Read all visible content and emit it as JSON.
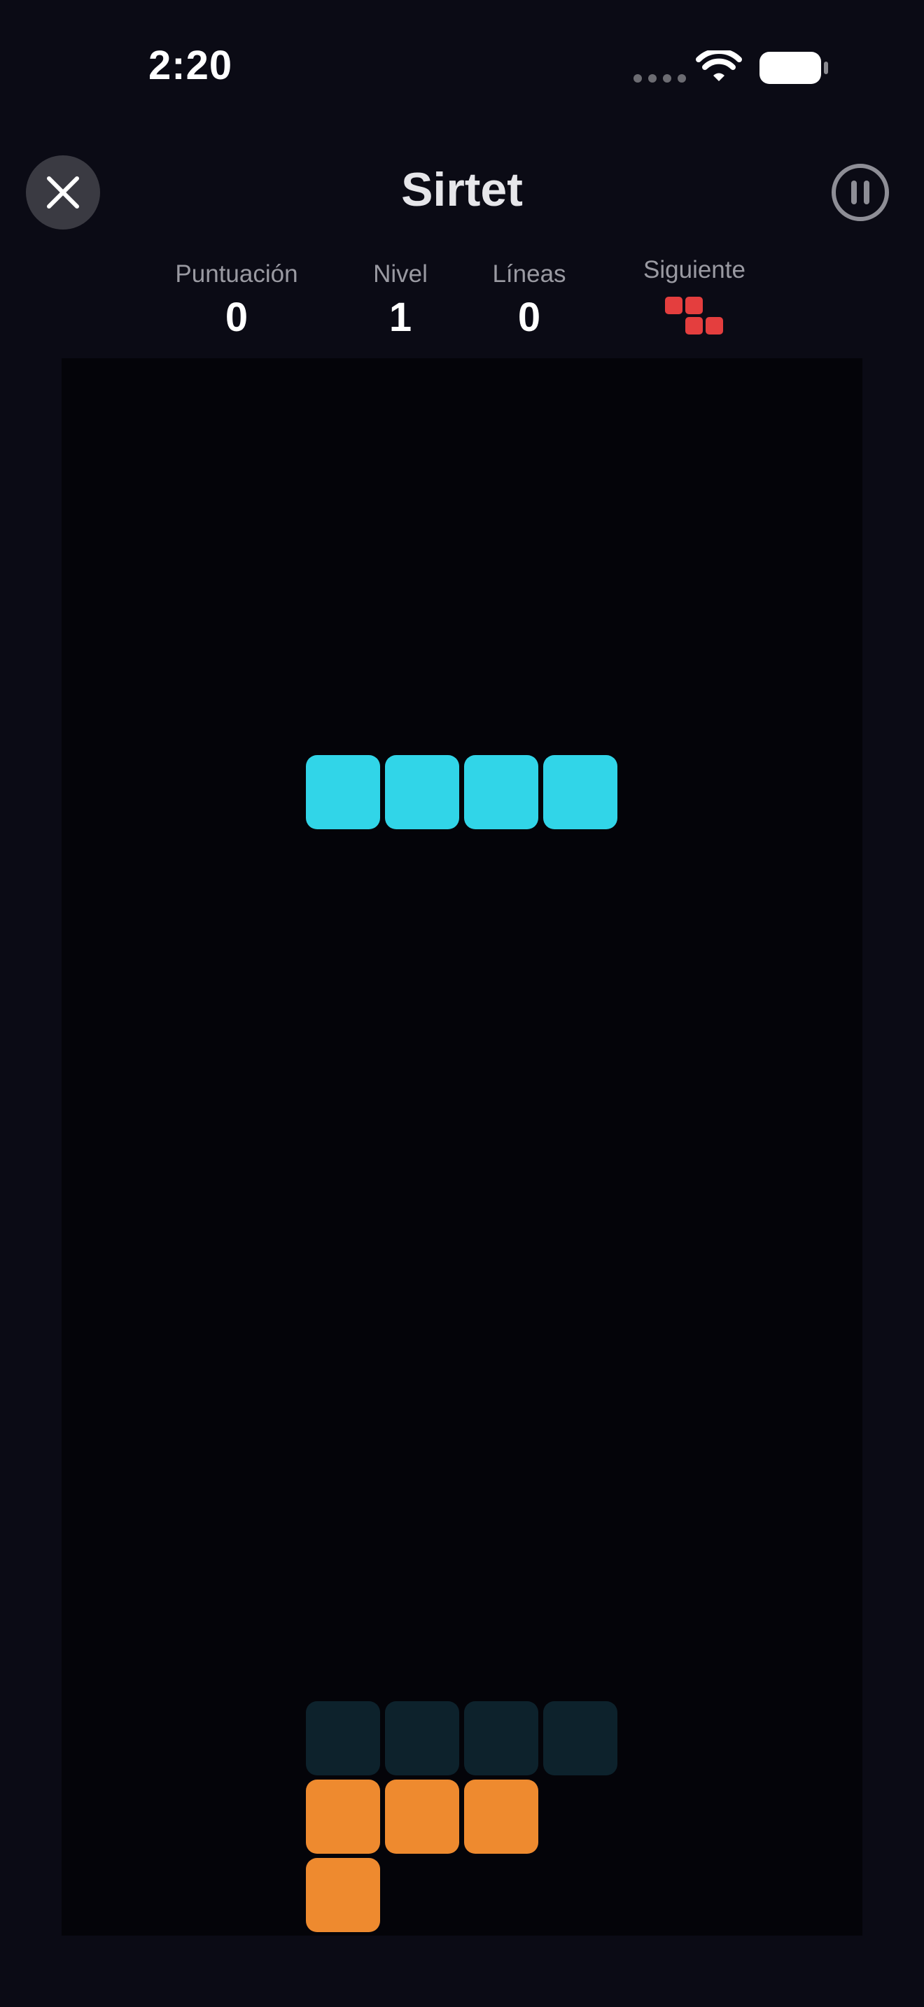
{
  "status_bar": {
    "time": "2:20",
    "icons": [
      "signal-dots-icon",
      "wifi-icon",
      "battery-icon"
    ]
  },
  "header": {
    "title": "Sirtet",
    "close_icon": "close-icon",
    "pause_icon": "pause-icon"
  },
  "stats": {
    "score_label": "Puntuación",
    "score_value": "0",
    "level_label": "Nivel",
    "level_value": "1",
    "lines_label": "Líneas",
    "lines_value": "0",
    "next_label": "Siguiente",
    "next_piece": {
      "shape": "Z",
      "color": "#e43e3e"
    }
  },
  "board": {
    "columns": 10,
    "background": "#040409",
    "active_piece": {
      "shape": "I",
      "color": "#31d5e8"
    },
    "ghost_piece": {
      "shape": "I",
      "color": "#0d222c"
    },
    "locked_piece": {
      "shape": "L",
      "color": "#ee8a2f"
    }
  },
  "colors": {
    "background": "#0b0b15",
    "active": "#31d5e8",
    "ghost": "#0d222c",
    "locked": "#ee8a2f",
    "next": "#e43e3e"
  }
}
